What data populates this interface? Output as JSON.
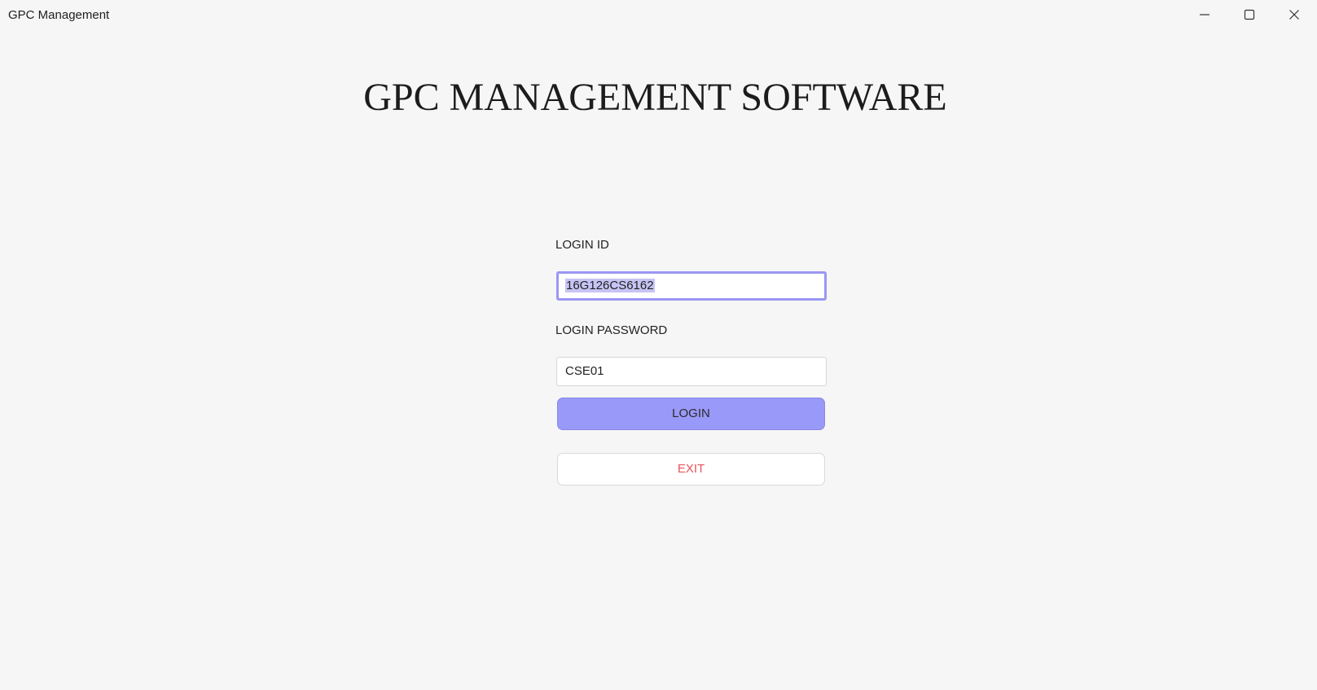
{
  "window": {
    "title": "GPC Management"
  },
  "main": {
    "heading": "GPC MANAGEMENT SOFTWARE",
    "login_id_label": "LOGIN ID",
    "login_id_value": "16G126CS6162",
    "login_password_label": "LOGIN PASSWORD",
    "login_password_value": "CSE01",
    "login_button_label": "LOGIN",
    "exit_button_label": "EXIT"
  },
  "icons": {
    "minimize": "minimize-icon",
    "maximize": "maximize-icon",
    "close": "close-icon"
  },
  "colors": {
    "background": "#f6f6f6",
    "login_button": "#9999f9",
    "focus_border": "#9b97f3",
    "exit_text": "#e8555e"
  }
}
